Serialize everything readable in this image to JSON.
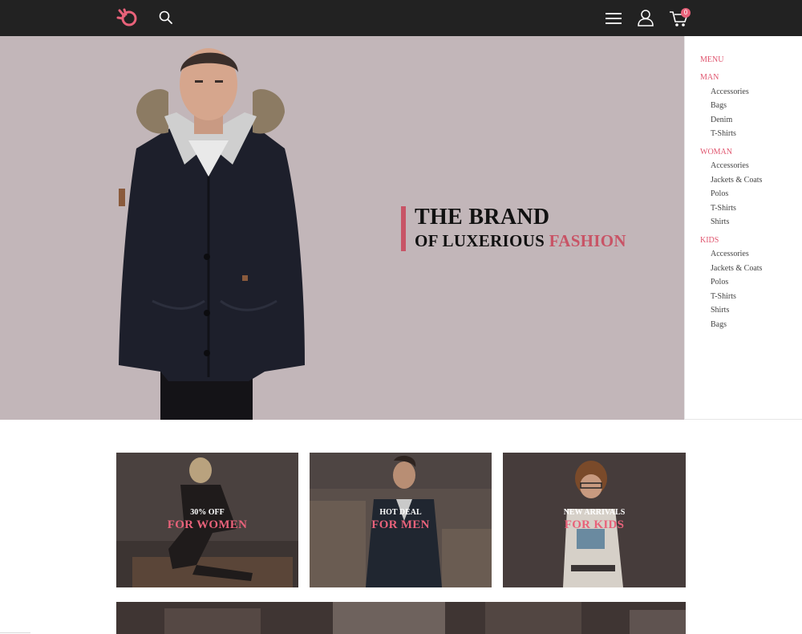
{
  "header": {
    "logo_icon": "hand-circle-logo",
    "cart_count": "0",
    "colors": {
      "bar": "#222222",
      "accent": "#e8627a"
    }
  },
  "hero": {
    "line1": "THE BRAND",
    "line2_prefix": "OF LUXERIOUS ",
    "line2_accent": "FASHION",
    "colors": {
      "background": "#c2b6b9",
      "accent": "#c85466"
    }
  },
  "side_menu": {
    "title": "MENU",
    "groups": [
      {
        "label": "MAN",
        "items": [
          "Accessories",
          "Bags",
          "Denim",
          "T-Shirts"
        ]
      },
      {
        "label": "WOMAN",
        "items": [
          "Accessories",
          "Jackets & Coats",
          "Polos",
          "T-Shirts",
          "Shirts"
        ]
      },
      {
        "label": "KIDS",
        "items": [
          "Accessories",
          "Jackets & Coats",
          "Polos",
          "T-Shirts",
          "Shirts",
          "Bags"
        ]
      }
    ]
  },
  "promos": [
    {
      "small": "30% OFF",
      "big": "FOR WOMEN"
    },
    {
      "small": "HOT DEAL",
      "big": "FOR MEN"
    },
    {
      "small": "NEW ARRIVALS",
      "big": "FOR KIDS"
    }
  ]
}
